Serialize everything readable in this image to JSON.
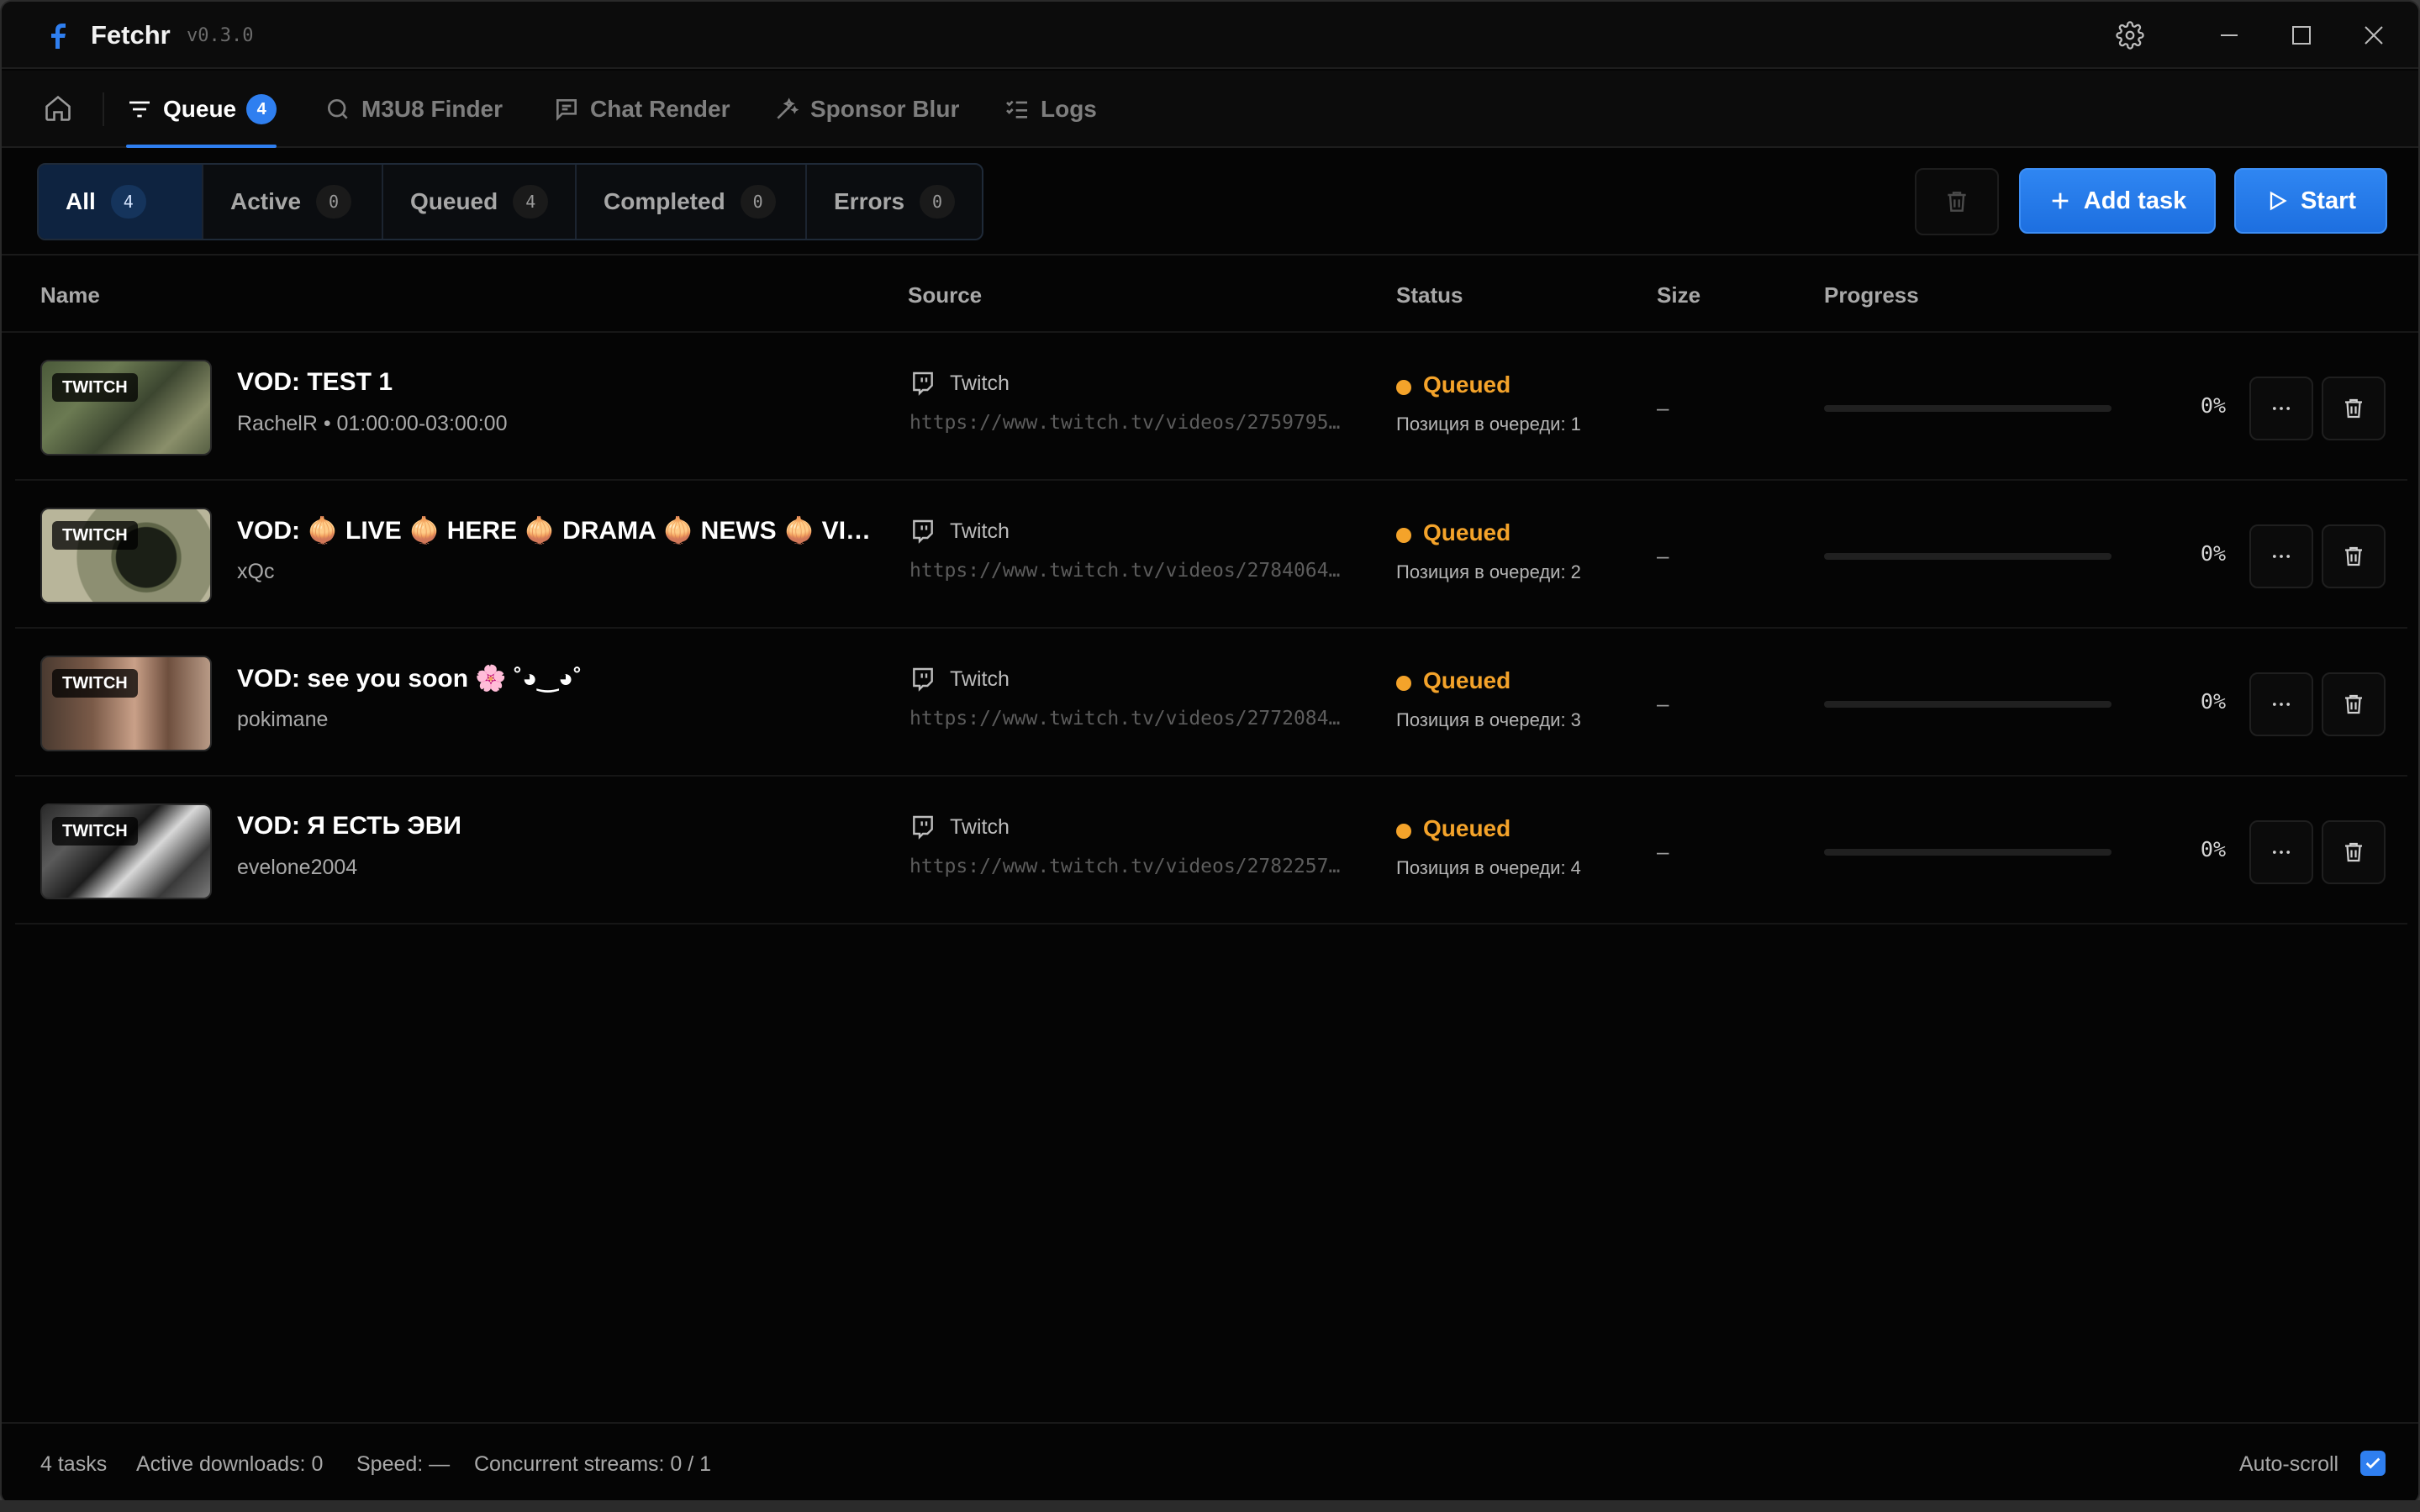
{
  "app": {
    "name": "Fetchr",
    "version": "v0.3.0"
  },
  "nav": {
    "tabs": [
      {
        "label": "Queue",
        "badge": "4"
      },
      {
        "label": "M3U8 Finder"
      },
      {
        "label": "Chat Render"
      },
      {
        "label": "Sponsor Blur"
      },
      {
        "label": "Logs"
      }
    ]
  },
  "filters": [
    {
      "label": "All",
      "count": "4"
    },
    {
      "label": "Active",
      "count": "0"
    },
    {
      "label": "Queued",
      "count": "4"
    },
    {
      "label": "Completed",
      "count": "0"
    },
    {
      "label": "Errors",
      "count": "0"
    }
  ],
  "actions": {
    "add_task": "Add task",
    "start": "Start"
  },
  "table": {
    "headers": {
      "name": "Name",
      "source": "Source",
      "status": "Status",
      "size": "Size",
      "progress": "Progress"
    },
    "rows": [
      {
        "badge": "TWITCH",
        "title": "VOD: TEST 1",
        "subtitle": "RachelR • 01:00:00-03:00:00",
        "source": "Twitch",
        "url": "https://www.twitch.tv/videos/2759795…",
        "status": "Queued",
        "position": "Позиция в очереди: 1",
        "size": "–",
        "progress": 0,
        "progress_label": "0%"
      },
      {
        "badge": "TWITCH",
        "title": "VOD:  🧅 LIVE 🧅 HERE 🧅 DRAMA 🧅 NEWS 🧅 VIDEOS…",
        "subtitle": "xQc",
        "source": "Twitch",
        "url": "https://www.twitch.tv/videos/2784064…",
        "status": "Queued",
        "position": "Позиция в очереди: 2",
        "size": "–",
        "progress": 0,
        "progress_label": "0%"
      },
      {
        "badge": "TWITCH",
        "title": "VOD: see you soon 🌸 ˚◕‿◕˚",
        "subtitle": "pokimane",
        "source": "Twitch",
        "url": "https://www.twitch.tv/videos/2772084…",
        "status": "Queued",
        "position": "Позиция в очереди: 3",
        "size": "–",
        "progress": 0,
        "progress_label": "0%"
      },
      {
        "badge": "TWITCH",
        "title": "VOD: Я ЕСТЬ ЭВИ",
        "subtitle": "evelone2004",
        "source": "Twitch",
        "url": "https://www.twitch.tv/videos/2782257…",
        "status": "Queued",
        "position": "Позиция в очереди: 4",
        "size": "–",
        "progress": 0,
        "progress_label": "0%"
      }
    ]
  },
  "footer": {
    "tasks": "4 tasks",
    "active_downloads": "Active downloads: 0",
    "speed": "Speed: —",
    "streams": "Concurrent streams: 0 / 1",
    "autoscroll": "Auto-scroll",
    "autoscroll_checked": true
  },
  "colors": {
    "accent": "#2f7ff0",
    "queued": "#f4a32a"
  }
}
